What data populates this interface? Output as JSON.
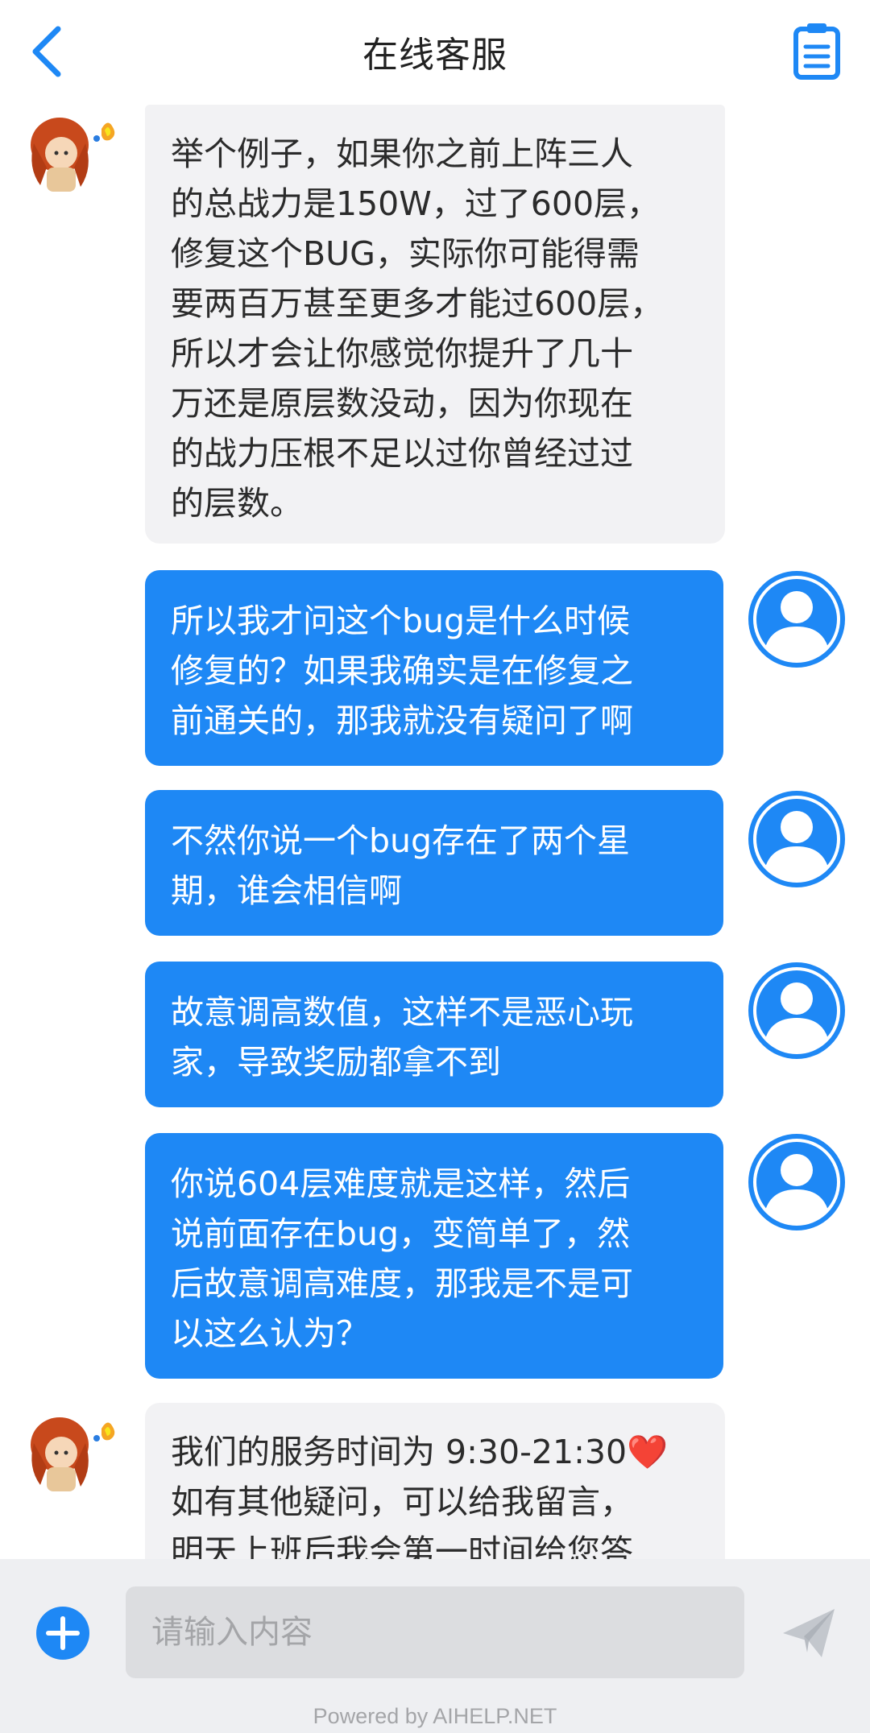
{
  "header": {
    "title": "在线客服",
    "back_icon": "chevron-left-icon",
    "orders_icon": "clipboard-list-icon",
    "accent_color": "#1e88f5"
  },
  "messages": [
    {
      "sender": "agent",
      "text": "举个例子，如果你之前上阵三人\n的总战力是150W，过了600层，\n修复这个BUG，实际你可能得需\n要两百万甚至更多才能过600层，\n所以才会让你感觉你提升了几十\n万还是原层数没动，因为你现在\n的战力压根不足以过你曾经过过\n的层数。"
    },
    {
      "sender": "user",
      "text": "所以我才问这个bug是什么时候\n修复的？如果我确实是在修复之\n前通关的，那我就没有疑问了啊"
    },
    {
      "sender": "user",
      "text": "不然你说一个bug存在了两个星\n期，谁会相信啊"
    },
    {
      "sender": "user",
      "text": "故意调高数值，这样不是恶心玩\n家，导致奖励都拿不到"
    },
    {
      "sender": "user",
      "text": "你说604层难度就是这样，然后\n说前面存在bug，变简单了，然\n后故意调高难度，那我是不是可\n以这么认为？"
    },
    {
      "sender": "agent",
      "text": "我们的服务时间为 9:30-21:30❤️\n如有其他疑问，可以给我留言，\n明天上班后我会第一时间给您答"
    }
  ],
  "input": {
    "placeholder": "请输入内容",
    "value": "",
    "plus_icon": "plus-circle-icon",
    "send_icon": "paper-plane-icon"
  },
  "footer": {
    "powered_by": "Powered by AIHELP.NET"
  },
  "colors": {
    "user_bubble": "#1e88f5",
    "agent_bubble": "#f2f2f4",
    "input_bar": "#eeeff2"
  }
}
